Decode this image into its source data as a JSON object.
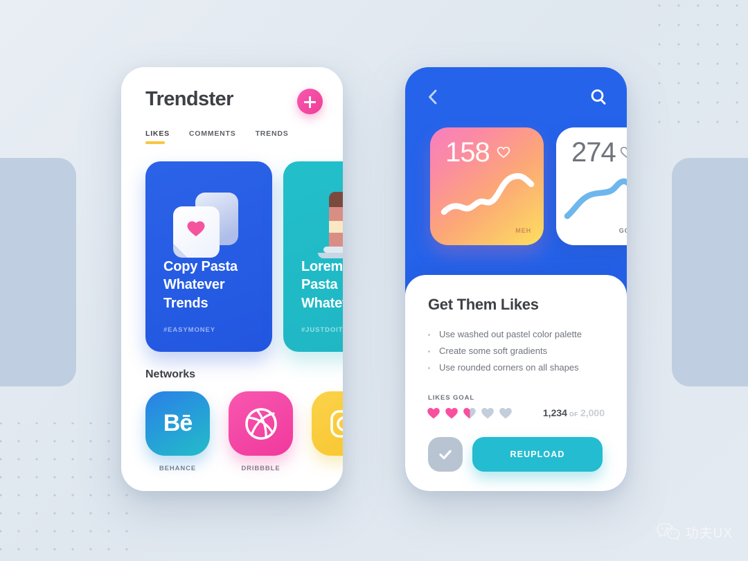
{
  "background": {
    "base_color": "#e6ecf2",
    "slab_color": "#bfcfe1",
    "dot_color": "#b9c6d4"
  },
  "left_phone": {
    "app_title": "Trendster",
    "add_button": {
      "icon": "plus-icon",
      "accent": "#f0459b"
    },
    "tabs": [
      {
        "label": "LIKES",
        "active": true
      },
      {
        "label": "COMMENTS",
        "active": false
      },
      {
        "label": "TRENDS",
        "active": false
      }
    ],
    "tab_indicator_color": "#f9c543",
    "cards": [
      {
        "title": "Copy Pasta\nWhatever\nTrends",
        "tag": "#EASYMONEY",
        "color": "#2256e0",
        "art": "heart-note-icon"
      },
      {
        "title": "Lorem\nPasta\nWhatever",
        "tag": "#JUSTDOIT",
        "color": "#1fb6c4",
        "art": "cake-icon"
      }
    ],
    "networks_title": "Networks",
    "networks": [
      {
        "label": "BEHANCE",
        "icon": "behance-icon",
        "glyph": "Bē",
        "color": "#23bdc8"
      },
      {
        "label": "DRIBBBLE",
        "icon": "dribbble-icon",
        "glyph": "",
        "color": "#f0399c"
      },
      {
        "label": "",
        "icon": "instagram-icon",
        "glyph": "",
        "color": "#f8c62e"
      }
    ]
  },
  "right_phone": {
    "nav": {
      "back_icon": "chevron-left-icon",
      "search_icon": "search-icon"
    },
    "stat_cards": [
      {
        "value": "158",
        "footer": "MEH",
        "heart_icon": "heart-outline-icon",
        "style": "gradient",
        "trend": "wavy-flat"
      },
      {
        "value": "274",
        "footer": "GOOD JUB",
        "heart_icon": "heart-outline-icon",
        "style": "white",
        "trend": "rising"
      }
    ],
    "sheet": {
      "title": "Get Them Likes",
      "bullets": [
        "Use washed out pastel color palette",
        "Create some soft gradients",
        "Use rounded corners on all shapes"
      ],
      "goal_label": "LIKES GOAL",
      "hearts_filled": 2,
      "hearts_half": 1,
      "hearts_total": 5,
      "heart_fill_color": "#f8509f",
      "heart_empty_color": "#c3cedb",
      "current": "1,234",
      "of_word": "OF",
      "target": "2,000",
      "check_button_icon": "check-icon",
      "reupload_label": "REUPLOAD",
      "reupload_color": "#24bcd0"
    }
  },
  "watermark": {
    "icon": "wechat-icon",
    "text": "功夫UX"
  }
}
